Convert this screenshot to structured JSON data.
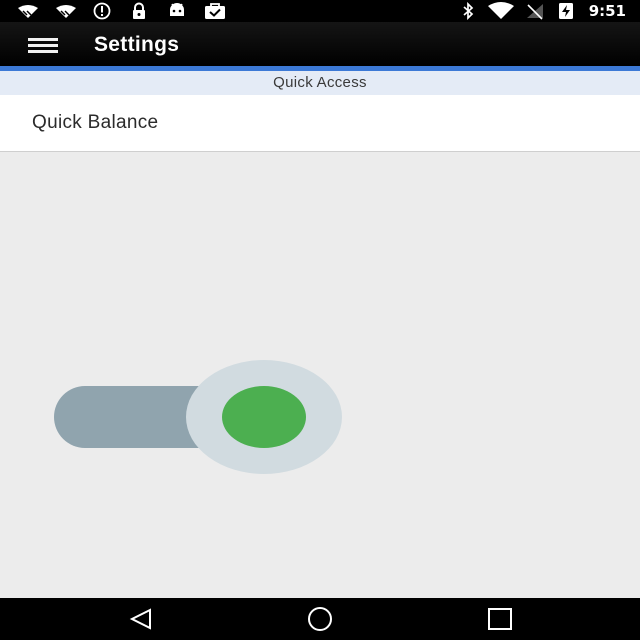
{
  "status_bar": {
    "time": "9:51",
    "left_icons": [
      "wifi-call-icon",
      "wifi-call-icon",
      "alert-circle-icon",
      "lock-icon",
      "android-icon",
      "briefcase-check-icon"
    ],
    "right_icons": [
      "bluetooth-icon",
      "wifi-icon",
      "signal-off-icon",
      "battery-charging-icon"
    ]
  },
  "app_bar": {
    "menu_icon": "hamburger-menu-icon",
    "title": "Settings"
  },
  "section": {
    "header": "Quick Access"
  },
  "list": {
    "items": [
      {
        "label": "Quick Balance"
      }
    ]
  },
  "toggle": {
    "state": "on",
    "thumb_color": "#4caf50",
    "track_color": "#90a4ae",
    "halo_color": "#d1dbe0"
  },
  "nav_bar": {
    "buttons": [
      "back-icon",
      "home-icon",
      "recents-icon"
    ]
  },
  "colors": {
    "accent": "#3c79d6",
    "section_header_bg": "#e4ebf6",
    "background": "#ececec"
  }
}
